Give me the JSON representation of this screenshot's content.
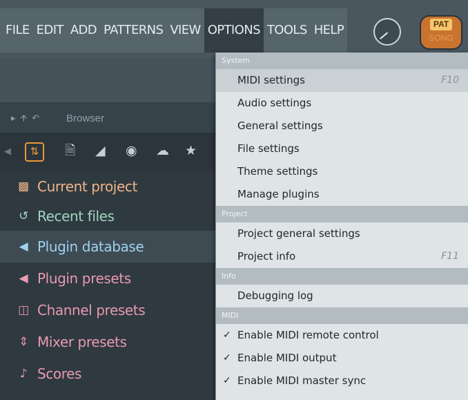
{
  "menubar": {
    "items": [
      "FILE",
      "EDIT",
      "ADD",
      "PATTERNS",
      "VIEW",
      "OPTIONS",
      "TOOLS",
      "HELP"
    ],
    "pat_label": "PAT",
    "song_label": "SONG"
  },
  "browser": {
    "header": "Browser",
    "items": [
      {
        "label": "Current project",
        "icon": "page-icon",
        "color": "#f0b58a"
      },
      {
        "label": "Recent files",
        "icon": "folder-arrow-icon",
        "color": "#9ed6c0"
      },
      {
        "label": "Plugin database",
        "icon": "speaker-icon",
        "color": "#9ed1f0"
      },
      {
        "label": "Plugin presets",
        "icon": "speaker-icon",
        "color": "#e89ab0"
      },
      {
        "label": "Channel presets",
        "icon": "channel-icon",
        "color": "#e89ab0"
      },
      {
        "label": "Mixer presets",
        "icon": "mixer-icon",
        "color": "#e89ab0"
      },
      {
        "label": "Scores",
        "icon": "note-icon",
        "color": "#e89ab0"
      }
    ]
  },
  "options_menu": {
    "sections": [
      {
        "title": "System",
        "items": [
          {
            "label": "MIDI settings",
            "shortcut": "F10"
          },
          {
            "label": "Audio settings",
            "shortcut": ""
          },
          {
            "label": "General settings",
            "shortcut": ""
          },
          {
            "label": "File settings",
            "shortcut": ""
          },
          {
            "label": "Theme settings",
            "shortcut": ""
          },
          {
            "label": "Manage plugins",
            "shortcut": ""
          }
        ]
      },
      {
        "title": "Project",
        "items": [
          {
            "label": "Project general settings",
            "shortcut": ""
          },
          {
            "label": "Project info",
            "shortcut": "F11"
          }
        ]
      },
      {
        "title": "Info",
        "items": [
          {
            "label": "Debugging log",
            "shortcut": ""
          }
        ]
      },
      {
        "title": "MIDI",
        "items": [
          {
            "label": "Enable MIDI remote control",
            "checked": true
          },
          {
            "label": "Enable MIDI output",
            "checked": true
          },
          {
            "label": "Enable MIDI master sync",
            "checked": true
          }
        ]
      }
    ]
  },
  "colors": {
    "accent": "#e99a3a",
    "menu_bg": "#dfe4e6",
    "section_bg": "#b2bcc1"
  }
}
